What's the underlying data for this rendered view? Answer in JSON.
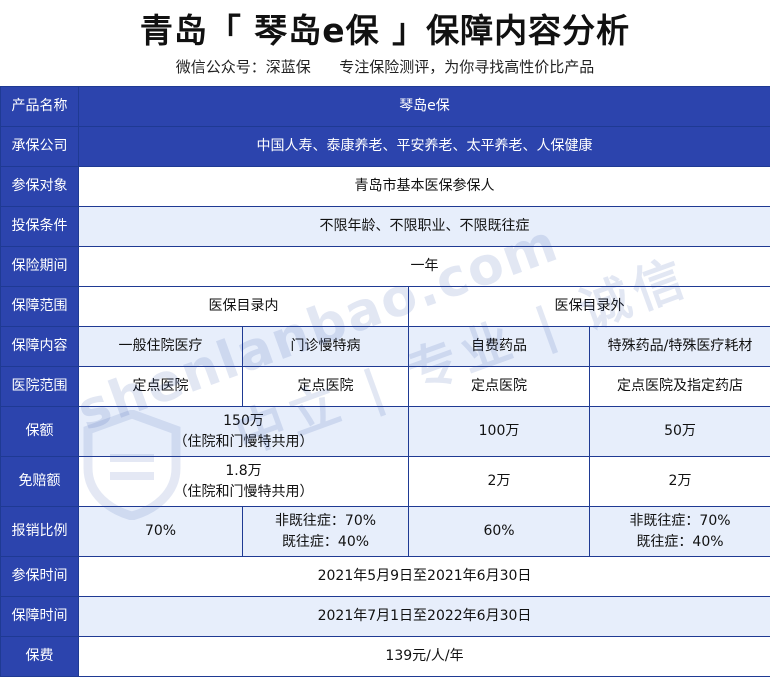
{
  "title": "青岛「 琴岛e保 」保障内容分析",
  "subtitle": "微信公众号：深蓝保      专注保险测评，为你寻找高性价比产品",
  "watermark": {
    "url": "shenlanbao.com",
    "slogan": "中立 | 专业 | 诚信"
  },
  "table": {
    "product_name": {
      "label": "产品名称",
      "value": "琴岛e保"
    },
    "insurer": {
      "label": "承保公司",
      "value": "中国人寿、泰康养老、平安养老、太平养老、人保健康"
    },
    "eligible": {
      "label": "参保对象",
      "value": "青岛市基本医保参保人"
    },
    "conditions": {
      "label": "投保条件",
      "value": "不限年龄、不限职业、不限既往症"
    },
    "period": {
      "label": "保险期间",
      "value": "一年"
    },
    "scope": {
      "label": "保障范围",
      "in_list": "医保目录内",
      "out_list": "医保目录外"
    },
    "content": {
      "label": "保障内容",
      "cols": [
        "一般住院医疗",
        "门诊慢特病",
        "自费药品",
        "特殊药品/特殊医疗耗材"
      ]
    },
    "hospital": {
      "label": "医院范围",
      "cols": [
        "定点医院",
        "定点医院",
        "定点医院",
        "定点医院及指定药店"
      ]
    },
    "amount": {
      "label": "保额",
      "in_list": "150万",
      "in_list_note": "（住院和门慢特共用）",
      "drugs": "100万",
      "special": "50万"
    },
    "deductible": {
      "label": "免赔额",
      "in_list": "1.8万",
      "in_list_note": "（住院和门慢特共用）",
      "drugs": "2万",
      "special": "2万"
    },
    "ratio": {
      "label": "报销比例",
      "inpatient": "70%",
      "outpatient_line1": "非既往症：70%",
      "outpatient_line2": "既往症：40%",
      "drugs": "60%",
      "special_line1": "非既往症：70%",
      "special_line2": "既往症：40%"
    },
    "enroll_time": {
      "label": "参保时间",
      "value": "2021年5月9日至2021年6月30日"
    },
    "cover_time": {
      "label": "保障时间",
      "value": "2021年7月1日至2022年6月30日"
    },
    "premium": {
      "label": "保费",
      "value": "139元/人/年"
    }
  },
  "colors": {
    "header_blue": "#2c44ad",
    "row_light": "#e7eefb",
    "border": "#1f3a93"
  }
}
